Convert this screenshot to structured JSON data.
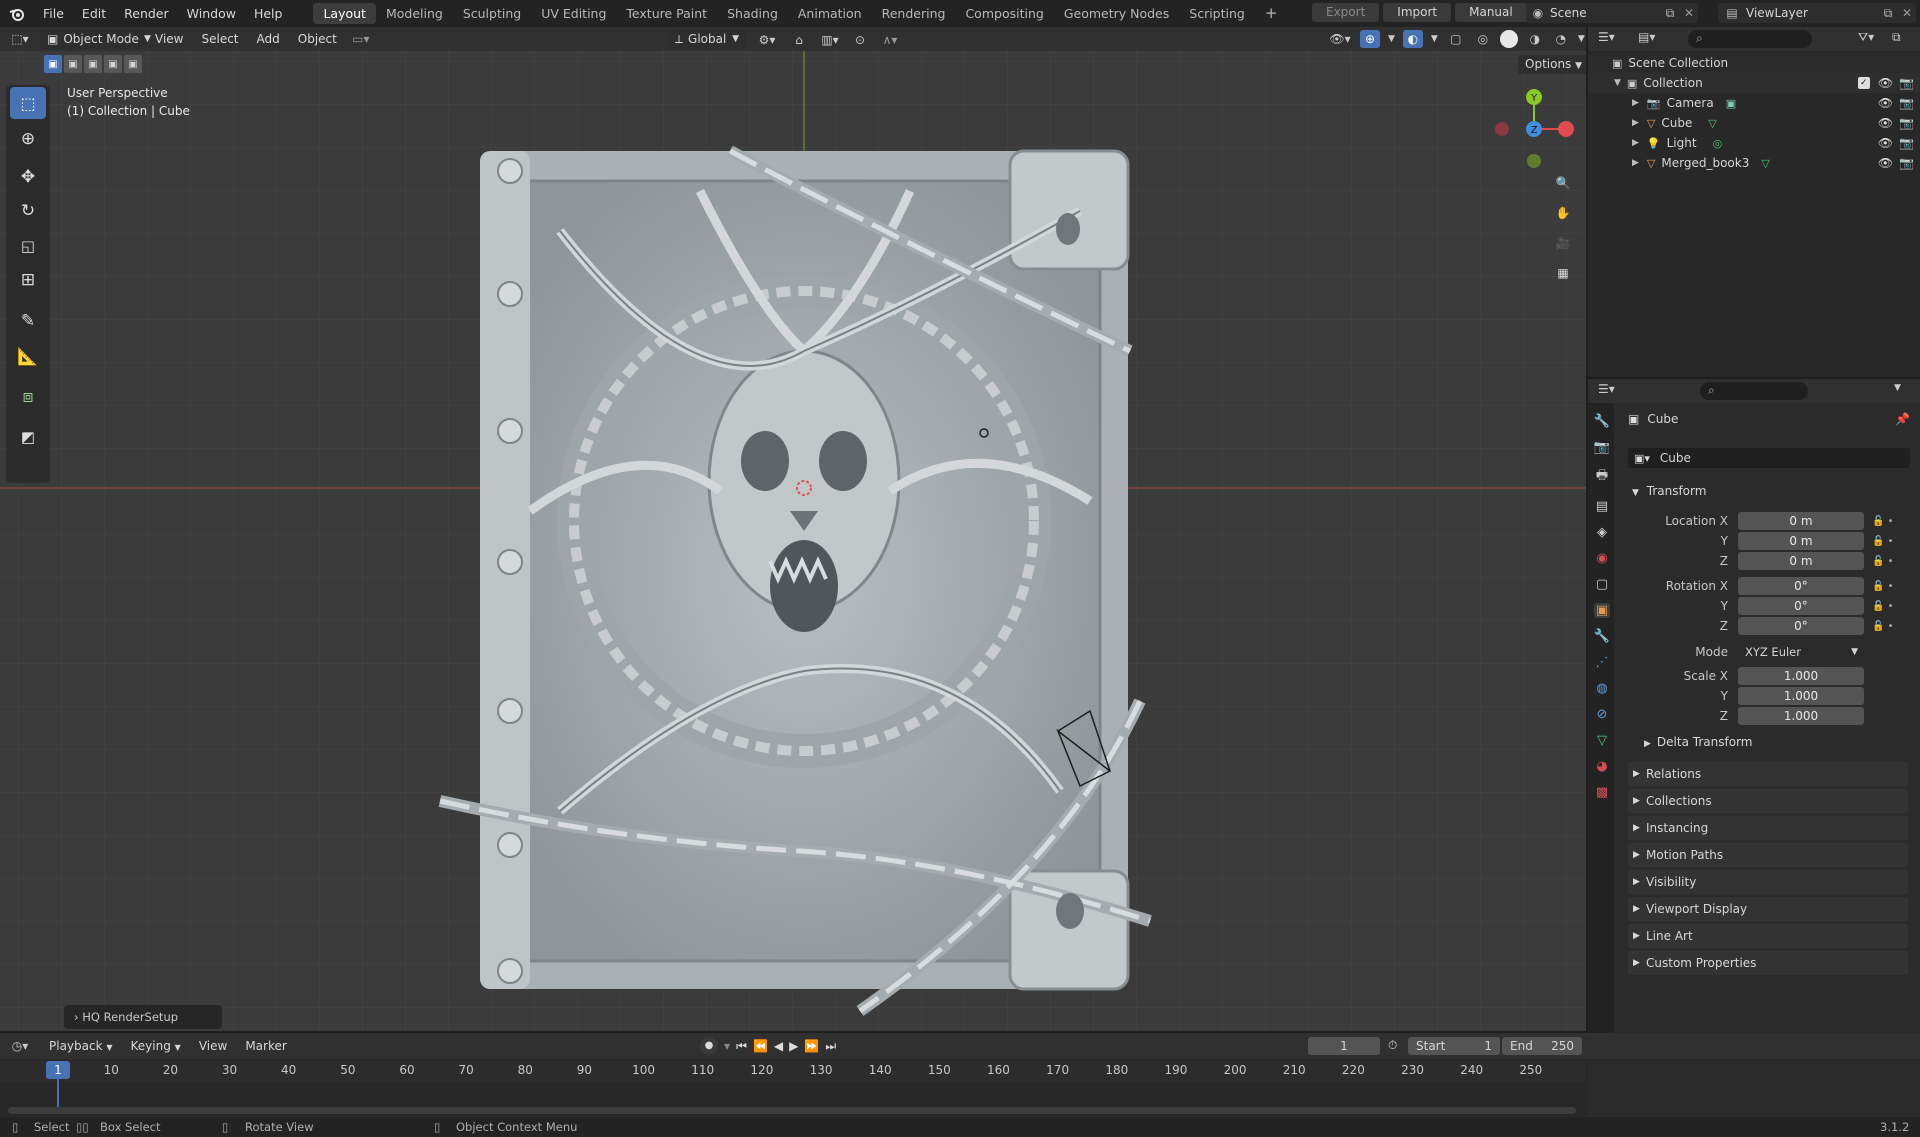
{
  "app": {
    "version": "3.1.2"
  },
  "menu": [
    "File",
    "Edit",
    "Render",
    "Window",
    "Help"
  ],
  "workspaces": [
    "Layout",
    "Modeling",
    "Sculpting",
    "UV Editing",
    "Texture Paint",
    "Shading",
    "Animation",
    "Rendering",
    "Compositing",
    "Geometry Nodes",
    "Scripting"
  ],
  "active_workspace": "Layout",
  "topright": {
    "export": "Export",
    "import": "Import",
    "manual": "Manual",
    "scene": "Scene",
    "viewlayer": "ViewLayer"
  },
  "viewport_header": {
    "mode": "Object Mode",
    "menus": [
      "View",
      "Select",
      "Add",
      "Object"
    ],
    "orientation": "Global",
    "options": "Options"
  },
  "viewport": {
    "perspective": "User Perspective",
    "context": "(1) Collection | Cube",
    "last_op": "HQ RenderSetup"
  },
  "outliner": {
    "root": "Scene Collection",
    "collection": "Collection",
    "items": [
      {
        "name": "Camera",
        "icon": "camera-icon"
      },
      {
        "name": "Cube",
        "icon": "mesh-icon"
      },
      {
        "name": "Light",
        "icon": "light-icon"
      },
      {
        "name": "Merged_book3",
        "icon": "mesh-icon"
      }
    ]
  },
  "properties": {
    "object_name": "Cube",
    "data_name": "Cube",
    "transform_title": "Transform",
    "location": {
      "label_x": "Location X",
      "x": "0 m",
      "y": "0 m",
      "z": "0 m"
    },
    "rotation": {
      "label_x": "Rotation X",
      "x": "0°",
      "y": "0°",
      "z": "0°"
    },
    "mode_label": "Mode",
    "mode_value": "XYZ Euler",
    "scale": {
      "label_x": "Scale X",
      "x": "1.000",
      "y": "1.000",
      "z": "1.000"
    },
    "axis_y": "Y",
    "axis_z": "Z",
    "delta": "Delta Transform",
    "panels": [
      "Relations",
      "Collections",
      "Instancing",
      "Motion Paths",
      "Visibility",
      "Viewport Display",
      "Line Art",
      "Custom Properties"
    ]
  },
  "timeline": {
    "menus": [
      "Playback",
      "Keying",
      "View",
      "Marker"
    ],
    "current_frame": "1",
    "start_label": "Start",
    "start": "1",
    "end_label": "End",
    "end": "250",
    "ticks": [
      "10",
      "20",
      "30",
      "40",
      "50",
      "60",
      "70",
      "80",
      "90",
      "100",
      "110",
      "120",
      "130",
      "140",
      "150",
      "160",
      "170",
      "180",
      "190",
      "200",
      "210",
      "220",
      "230",
      "240",
      "250"
    ]
  },
  "status": {
    "select": "Select",
    "box_select": "Box Select",
    "rotate": "Rotate View",
    "context_menu": "Object Context Menu"
  },
  "colors": {
    "accent": "#4772b3",
    "axis_x": "#e34a50",
    "axis_y": "#8ac926",
    "axis_z": "#3f8ee0",
    "grid": "#464646"
  }
}
